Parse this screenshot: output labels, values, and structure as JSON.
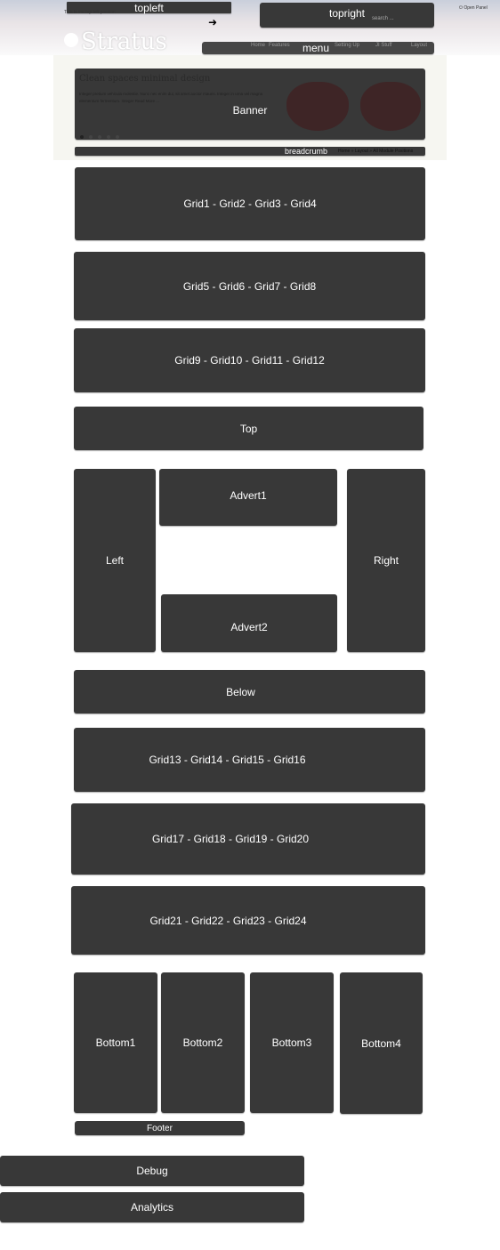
{
  "header": {
    "topleft_text": "This is the top left position",
    "topleft_label": "topleft",
    "topright_label": "topright",
    "search_placeholder": "search ...",
    "open_panel": "Open Panel",
    "logo": "Stratus",
    "menu_label": "menu",
    "menu_items": [
      "Home",
      "Features",
      "Setting Up",
      "JI Stuff",
      "Layout"
    ]
  },
  "banner": {
    "label": "Banner",
    "title": "Clean spaces minimal design",
    "text": "Integer pretium vehicula molestie. Nunc nec enim dui, sit amet auctor mauris. Integer in urna vel magna elementum fermentum. Integer Read More ...",
    "slide_count": 5
  },
  "breadcrumb": {
    "label": "breadcrumb",
    "items": "Home » Layout » All Module Positions"
  },
  "modules": {
    "grid1": "Grid1 - Grid2 - Grid3 - Grid4",
    "grid5": "Grid5 - Grid6 - Grid7 - Grid8",
    "grid9": "Grid9 - Grid10 - Grid11 - Grid12",
    "top": "Top",
    "left": "Left",
    "advert1": "Advert1",
    "advert2": "Advert2",
    "right": "Right",
    "below": "Below",
    "grid13": "Grid13 - Grid14 - Grid15 - Grid16",
    "grid17": "Grid17 - Grid18 - Grid19 - Grid20",
    "grid21": "Grid21 - Grid22 - Grid23 - Grid24",
    "bottom1": "Bottom1",
    "bottom2": "Bottom2",
    "bottom3": "Bottom3",
    "bottom4": "Bottom4",
    "footer": "Footer",
    "debug": "Debug",
    "analytics": "Analytics"
  }
}
